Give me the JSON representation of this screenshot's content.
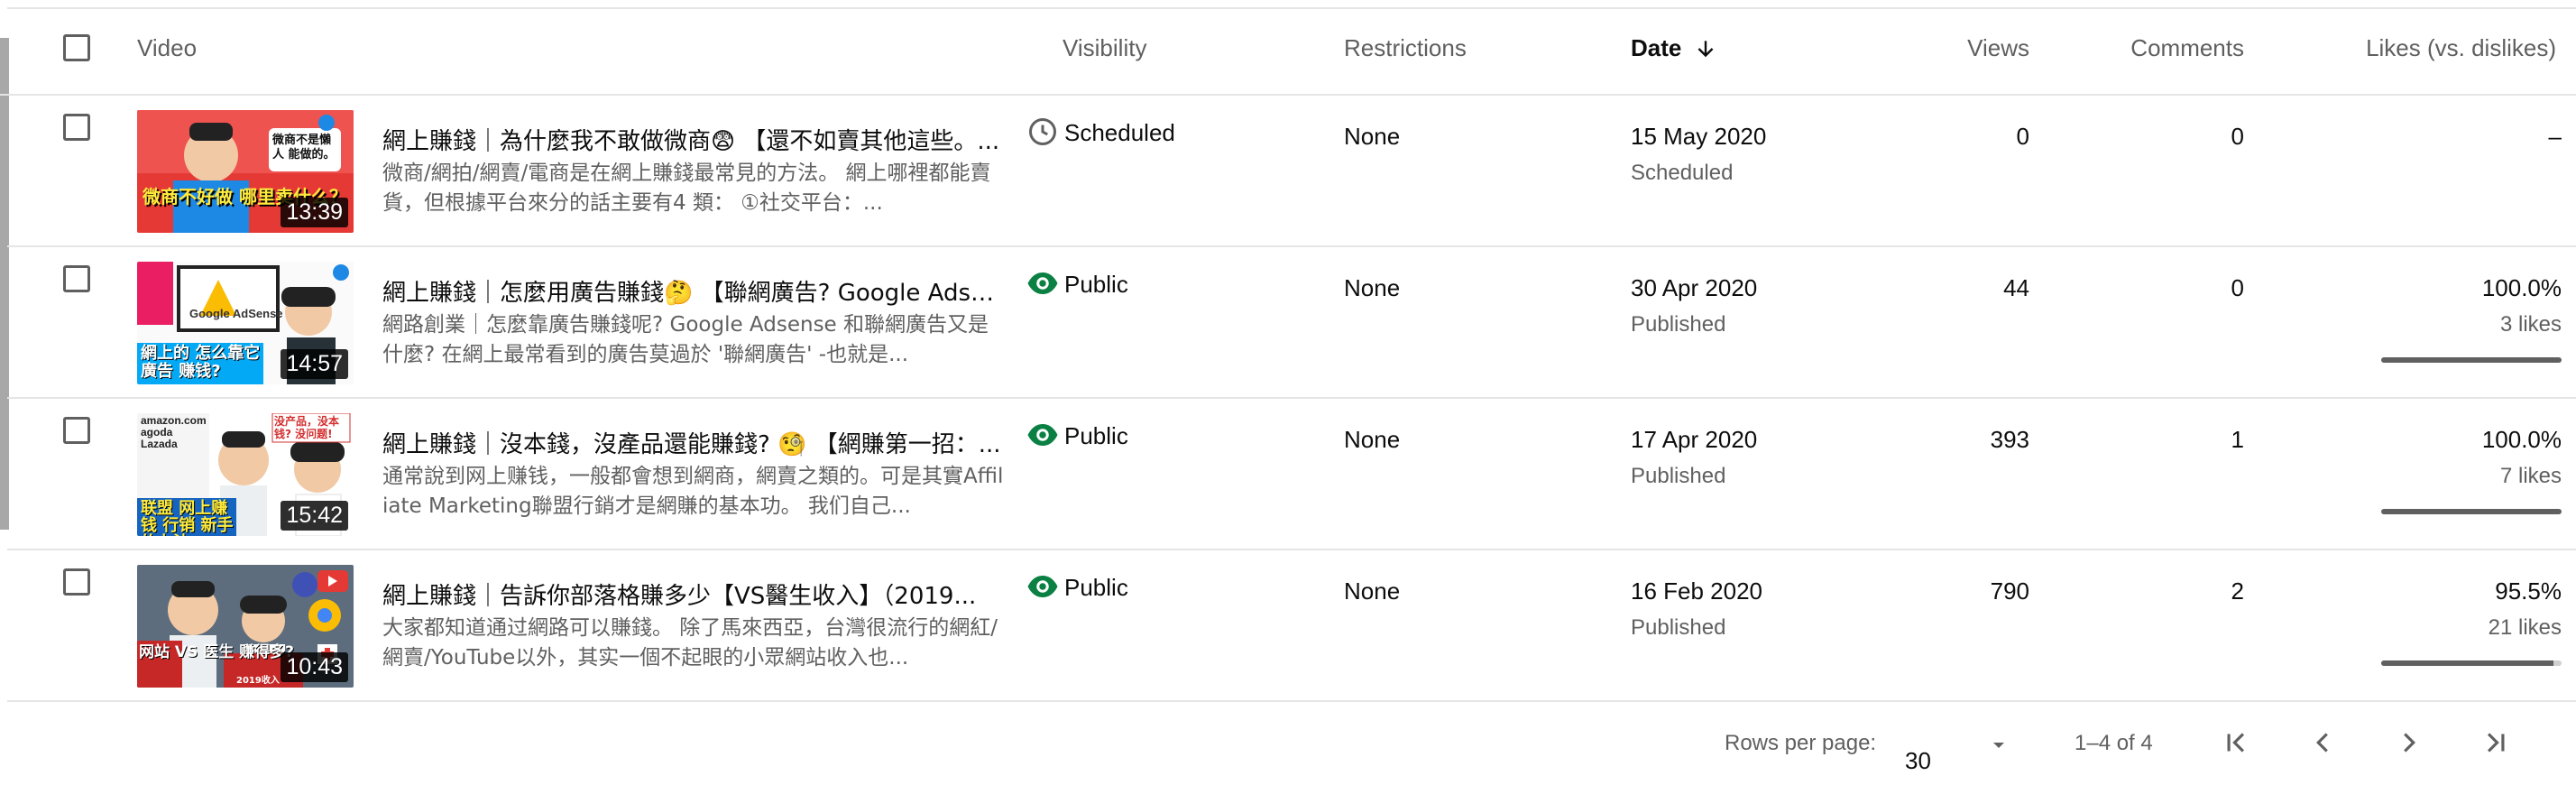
{
  "header": {
    "video": "Video",
    "visibility": "Visibility",
    "restrictions": "Restrictions",
    "date": "Date",
    "views": "Views",
    "comments": "Comments",
    "likes": "Likes (vs. dislikes)"
  },
  "rows": [
    {
      "title": "網上賺錢｜為什麼我不敢做微商😨 【還不如賣其他這些。...",
      "description": "微商/網拍/網賣/電商是在網上賺錢最常見的方法。 網上哪裡都能賣貨，但根據平台來分的話主要有4 類： ①社交平台：...",
      "duration": "13:39",
      "thumb_caption": "微商不好做 哪里卖什么？",
      "thumb_bubble": "微商不是懶人 能做的。",
      "visibility": "Scheduled",
      "visibility_icon": "clock-icon",
      "restrictions": "None",
      "date": "15 May 2020",
      "status": "Scheduled",
      "views": "0",
      "comments": "0",
      "likes": "–",
      "likes_count": "",
      "like_ratio": null
    },
    {
      "title": "網上賺錢｜怎麼用廣告賺錢🤔 【聯網廣告? Google Adse...",
      "description": "網路創業｜怎麼靠廣告賺錢呢? Google Adsense 和聯網廣告又是什麼? 在網上最常看到的廣告莫過於 '聯網廣告' -也就是...",
      "duration": "14:57",
      "thumb_caption": "網上的 怎么靠它 廣告 赚钱?",
      "thumb_bubble": "Google AdSense",
      "visibility": "Public",
      "visibility_icon": "eye-icon",
      "restrictions": "None",
      "date": "30 Apr 2020",
      "status": "Published",
      "views": "44",
      "comments": "0",
      "likes": "100.0%",
      "likes_count": "3 likes",
      "like_ratio": 1.0
    },
    {
      "title": "網上賺錢｜沒本錢，沒產品還能賺錢? 🧐 【網賺第一招：...",
      "description": "通常說到网上赚钱，一般都會想到網商，網賣之類的。可是其實Affiliate Marketing聯盟行銷才是網賺的基本功。 我们自己...",
      "duration": "15:42",
      "thumb_caption": "联盟 网上赚钱 行销 新手的办法",
      "thumb_bubble": "没产品，没本钱? 没问题!",
      "visibility": "Public",
      "visibility_icon": "eye-icon",
      "restrictions": "None",
      "date": "17 Apr 2020",
      "status": "Published",
      "views": "393",
      "comments": "1",
      "likes": "100.0%",
      "likes_count": "7 likes",
      "like_ratio": 1.0
    },
    {
      "title": "網上賺錢｜告訴你部落格賺多少【VS醫生收入】（2019...",
      "description": "大家都知道通过網路可以賺錢。 除了馬來西亞，台灣很流行的網紅/網賣/YouTube以外，其实一個不起眼的小眾網站收入也...",
      "duration": "10:43",
      "thumb_caption": "网站 VS 医生 赚得多?",
      "thumb_bubble": "2019收入",
      "visibility": "Public",
      "visibility_icon": "eye-icon",
      "restrictions": "None",
      "date": "16 Feb 2020",
      "status": "Published",
      "views": "790",
      "comments": "2",
      "likes": "95.5%",
      "likes_count": "21 likes",
      "like_ratio": 0.955
    }
  ],
  "footer": {
    "rows_per_page_label": "Rows per page:",
    "rows_per_page_value": "30",
    "range": "1–4 of 4"
  },
  "colors": {
    "public_icon": "#0b8043",
    "scheduled_icon": "#606060",
    "text_secondary": "#606060",
    "divider": "#e5e5e5"
  }
}
